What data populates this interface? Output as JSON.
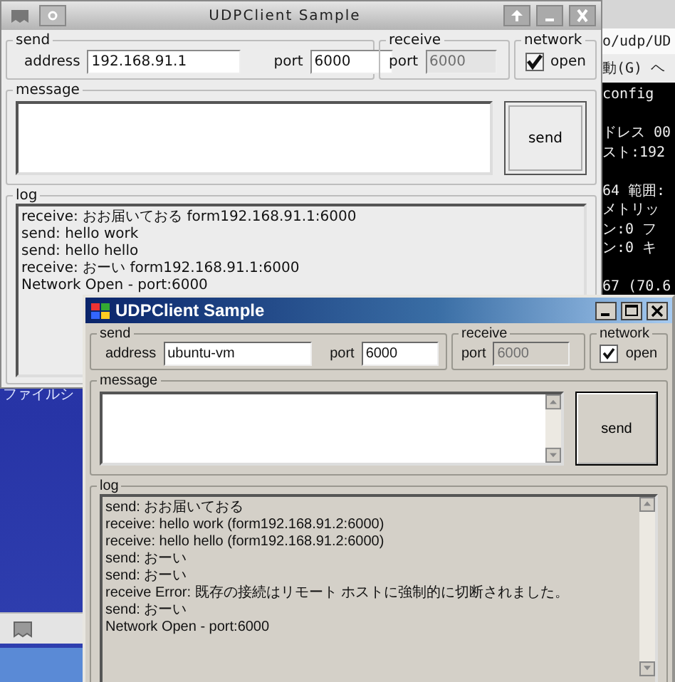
{
  "desktop": {
    "icon_label": "ファイルシ"
  },
  "terminal": {
    "path": "o/udp/UD",
    "menu": [
      "動(G)",
      "ヘ"
    ],
    "blocks": [
      [
        "config"
      ],
      [
        "ドレス 00",
        "スト:192"
      ],
      [
        "64 範囲:",
        "メトリッ",
        "ン:0 フ",
        "ン:0 キ"
      ],
      [
        "67 (70.6"
      ]
    ]
  },
  "windows": [
    {
      "kind": "gtk",
      "title": "UDPClient Sample",
      "send": {
        "group_label": "send",
        "address_label": "address",
        "address": "192.168.91.1",
        "port_label": "port",
        "port": "6000"
      },
      "receive": {
        "group_label": "receive",
        "port_label": "port",
        "port": "6000",
        "disabled": true
      },
      "network": {
        "group_label": "network",
        "checked": true,
        "label": "open"
      },
      "message": {
        "group_label": "message"
      },
      "send_button": "send",
      "log": {
        "group_label": "log",
        "lines": [
          "receive: おお届いておる form192.168.91.1:6000",
          "send: hello work",
          "send: hello hello",
          "receive: おーい form192.168.91.1:6000",
          "Network Open - port:6000"
        ]
      }
    },
    {
      "kind": "classic",
      "title": "UDPClient Sample",
      "send": {
        "group_label": "send",
        "address_label": "address",
        "address": "ubuntu-vm",
        "port_label": "port",
        "port": "6000"
      },
      "receive": {
        "group_label": "receive",
        "port_label": "port",
        "port": "6000",
        "disabled": true
      },
      "network": {
        "group_label": "network",
        "checked": true,
        "label": "open"
      },
      "message": {
        "group_label": "message"
      },
      "send_button": "send",
      "log": {
        "group_label": "log",
        "lines": [
          "send: おお届いておる",
          "receive: hello work (form192.168.91.2:6000)",
          "receive: hello hello (form192.168.91.2:6000)",
          "send: おーい",
          "send: おーい",
          "receive Error: 既存の接続はリモート ホストに強制的に切断されました。",
          "send: おーい",
          "Network Open - port:6000"
        ]
      }
    }
  ]
}
